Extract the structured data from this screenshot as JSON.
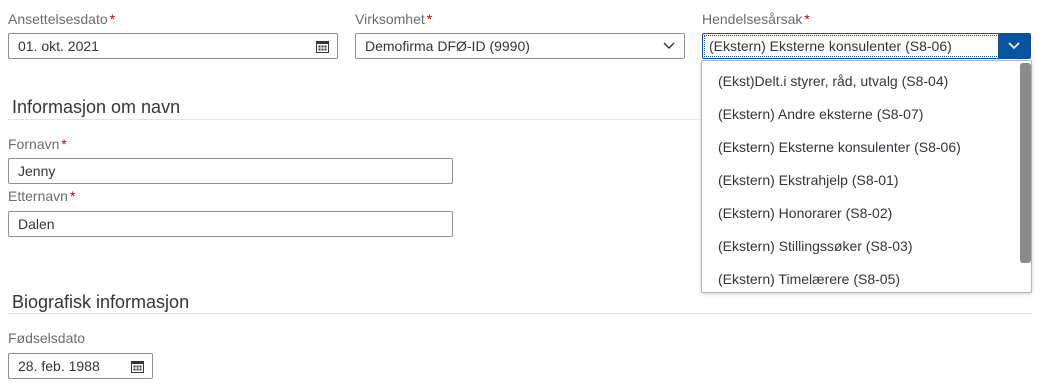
{
  "employment_date": {
    "label": "Ansettelsesdato",
    "required_marker": "*",
    "value": "01. okt. 2021",
    "icon": "calendar-icon"
  },
  "company": {
    "label": "Virksomhet",
    "required_marker": "*",
    "value": "Demofirma DFØ-ID (9990)",
    "icon": "chevron-down-icon"
  },
  "event_reason": {
    "label": "Hendelsesårsak",
    "required_marker": "*",
    "value": "(Ekstern) Eksterne konsulenter (S8-06)",
    "icon": "chevron-down-icon",
    "options": [
      "(Ekst)Delt.i styrer, råd, utvalg (S8-04)",
      "(Ekstern) Andre eksterne (S8-07)",
      "(Ekstern) Eksterne konsulenter (S8-06)",
      "(Ekstern) Ekstrahjelp (S8-01)",
      "(Ekstern) Honorarer (S8-02)",
      "(Ekstern) Stillingssøker (S8-03)",
      "(Ekstern) Timelærere (S8-05)"
    ]
  },
  "name_section": {
    "title": "Informasjon om navn",
    "first_name": {
      "label": "Fornavn",
      "required_marker": "*",
      "value": "Jenny"
    },
    "last_name": {
      "label": "Etternavn",
      "required_marker": "*",
      "value": "Dalen"
    }
  },
  "bio_section": {
    "title": "Biografisk informasjon",
    "birth_date": {
      "label": "Fødselsdato",
      "value": "28. feb. 1988",
      "icon": "calendar-icon"
    }
  },
  "colors": {
    "accent": "#0854a0",
    "required": "#bb0000",
    "text": "#32363a",
    "label": "#6a6d70",
    "border": "#89919a"
  }
}
